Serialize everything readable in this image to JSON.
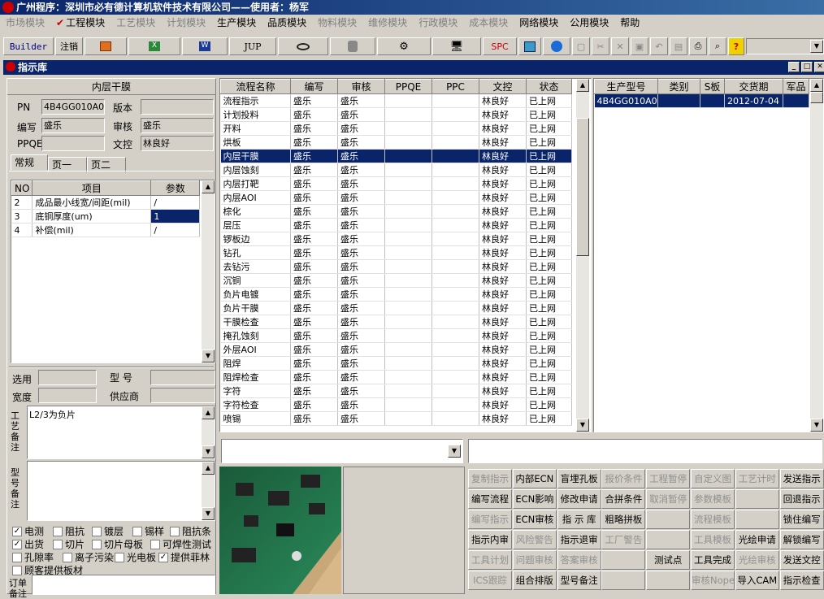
{
  "window": {
    "title": "广州程序：深圳市必有德计算机软件技术有限公司——使用者：杨军"
  },
  "menu": [
    {
      "label": "市场模块",
      "enabled": false
    },
    {
      "label": "工程模块",
      "enabled": true
    },
    {
      "label": "工艺模块",
      "enabled": false
    },
    {
      "label": "计划模块",
      "enabled": false
    },
    {
      "label": "生产模块",
      "enabled": true
    },
    {
      "label": "品质模块",
      "enabled": true
    },
    {
      "label": "物料模块",
      "enabled": false
    },
    {
      "label": "维修模块",
      "enabled": false
    },
    {
      "label": "行政模块",
      "enabled": false
    },
    {
      "label": "成本模块",
      "enabled": false
    },
    {
      "label": "网络模块",
      "enabled": true
    },
    {
      "label": "公用模块",
      "enabled": true
    },
    {
      "label": "帮助",
      "enabled": true
    }
  ],
  "toolbar": {
    "builder": "Builder",
    "logout": "注销",
    "jup": "JUP",
    "spc": "SPC"
  },
  "subwindow": {
    "title": "指示库"
  },
  "left": {
    "header": "内层干膜",
    "pn_label": "PN",
    "pn": "4B4GG010A0",
    "version_label": "版本",
    "version": "",
    "writer_label": "编写",
    "writer": "盛乐",
    "review_label": "审核",
    "review": "盛乐",
    "ppqe_label": "PPQE",
    "ppqe": "",
    "doc_label": "文控",
    "doc": "林良好",
    "tabs": [
      "常规",
      "页一",
      "页二"
    ],
    "param_headers": [
      "NO",
      "项目",
      "参数"
    ],
    "params": [
      {
        "no": "2",
        "item": "成品最小线宽/间距(mil)",
        "value": "/"
      },
      {
        "no": "3",
        "item": "底铜厚度(um)",
        "value": "1"
      },
      {
        "no": "4",
        "item": "补偿(mil)",
        "value": "/"
      }
    ],
    "select_label": "选用",
    "model_label": "型 号",
    "width_label": "宽度",
    "supplier_label": "供应商",
    "process_note_label": "工艺备注",
    "process_note": "L2/3为负片",
    "model_note_label": "型号备注",
    "order_note_label": "订单备注",
    "checks": [
      {
        "label": "电测",
        "checked": true
      },
      {
        "label": "阻抗",
        "checked": false
      },
      {
        "label": "镀层",
        "checked": false
      },
      {
        "label": "锡样",
        "checked": false
      },
      {
        "label": "阻抗条",
        "checked": false
      },
      {
        "label": "出货",
        "checked": true
      },
      {
        "label": "切片",
        "checked": false
      },
      {
        "label": "切片母板",
        "checked": false
      },
      {
        "label": "可焊性测试",
        "checked": false
      },
      {
        "label": "孔隙率",
        "checked": false
      },
      {
        "label": "离子污染",
        "checked": false
      },
      {
        "label": "光电板",
        "checked": false
      },
      {
        "label": "提供菲林",
        "checked": true
      },
      {
        "label": "顾客提供板材",
        "checked": false
      }
    ]
  },
  "flow": {
    "headers": [
      "流程名称",
      "编写",
      "审核",
      "PPQE",
      "PPC",
      "文控",
      "状态"
    ],
    "rows": [
      [
        "流程指示",
        "盛乐",
        "盛乐",
        "",
        "",
        "林良好",
        "已上网"
      ],
      [
        "计划投料",
        "盛乐",
        "盛乐",
        "",
        "",
        "林良好",
        "已上网"
      ],
      [
        "开料",
        "盛乐",
        "盛乐",
        "",
        "",
        "林良好",
        "已上网"
      ],
      [
        "烘板",
        "盛乐",
        "盛乐",
        "",
        "",
        "林良好",
        "已上网"
      ],
      [
        "内层干膜",
        "盛乐",
        "盛乐",
        "",
        "",
        "林良好",
        "已上网"
      ],
      [
        "内层蚀刻",
        "盛乐",
        "盛乐",
        "",
        "",
        "林良好",
        "已上网"
      ],
      [
        "内层打靶",
        "盛乐",
        "盛乐",
        "",
        "",
        "林良好",
        "已上网"
      ],
      [
        "内层AOI",
        "盛乐",
        "盛乐",
        "",
        "",
        "林良好",
        "已上网"
      ],
      [
        "棕化",
        "盛乐",
        "盛乐",
        "",
        "",
        "林良好",
        "已上网"
      ],
      [
        "层压",
        "盛乐",
        "盛乐",
        "",
        "",
        "林良好",
        "已上网"
      ],
      [
        "锣板边",
        "盛乐",
        "盛乐",
        "",
        "",
        "林良好",
        "已上网"
      ],
      [
        "钻孔",
        "盛乐",
        "盛乐",
        "",
        "",
        "林良好",
        "已上网"
      ],
      [
        "去钻污",
        "盛乐",
        "盛乐",
        "",
        "",
        "林良好",
        "已上网"
      ],
      [
        "沉铜",
        "盛乐",
        "盛乐",
        "",
        "",
        "林良好",
        "已上网"
      ],
      [
        "负片电镀",
        "盛乐",
        "盛乐",
        "",
        "",
        "林良好",
        "已上网"
      ],
      [
        "负片干膜",
        "盛乐",
        "盛乐",
        "",
        "",
        "林良好",
        "已上网"
      ],
      [
        "干膜检查",
        "盛乐",
        "盛乐",
        "",
        "",
        "林良好",
        "已上网"
      ],
      [
        "掩孔蚀刻",
        "盛乐",
        "盛乐",
        "",
        "",
        "林良好",
        "已上网"
      ],
      [
        "外层AOI",
        "盛乐",
        "盛乐",
        "",
        "",
        "林良好",
        "已上网"
      ],
      [
        "阻焊",
        "盛乐",
        "盛乐",
        "",
        "",
        "林良好",
        "已上网"
      ],
      [
        "阻焊检查",
        "盛乐",
        "盛乐",
        "",
        "",
        "林良好",
        "已上网"
      ],
      [
        "字符",
        "盛乐",
        "盛乐",
        "",
        "",
        "林良好",
        "已上网"
      ],
      [
        "字符检查",
        "盛乐",
        "盛乐",
        "",
        "",
        "林良好",
        "已上网"
      ],
      [
        "喷锡",
        "盛乐",
        "盛乐",
        "",
        "",
        "林良好",
        "已上网"
      ]
    ],
    "selected_index": 4
  },
  "orders": {
    "headers": [
      "生产型号",
      "类别",
      "S板",
      "交货期",
      "军品"
    ],
    "rows": [
      [
        "4B4GG010A0",
        "",
        "",
        "2012-07-04",
        ""
      ]
    ]
  },
  "commands": [
    [
      "复制指示",
      "内部ECN",
      "盲埋孔板",
      "报价条件",
      "工程暂停",
      "自定义图",
      "工艺计时",
      "发送指示"
    ],
    [
      "编写流程",
      "ECN影响",
      "修改申请",
      "合拼条件",
      "取消暂停",
      "参数模板",
      "",
      "回退指示"
    ],
    [
      "编写指示",
      "ECN审核",
      "指 示 库",
      "粗略拼板",
      "",
      "流程模板",
      "",
      "锁住编写"
    ],
    [
      "指示内审",
      "风险警告",
      "指示退审",
      "工厂警告",
      "",
      "工具模板",
      "光绘申请",
      "解锁编写"
    ],
    [
      "工具计划",
      "问题审核",
      "答案审核",
      "",
      "测试点",
      "工具完成",
      "光绘审核",
      "发送文控"
    ],
    [
      "ICS跟踪",
      "组合排版",
      "型号备注",
      "",
      "",
      "审核Nope",
      "导入CAM",
      "指示检查"
    ]
  ],
  "commands_disabled": [
    [
      true,
      false,
      false,
      true,
      true,
      true,
      true,
      false
    ],
    [
      false,
      false,
      false,
      false,
      true,
      true,
      false,
      false
    ],
    [
      true,
      false,
      false,
      false,
      false,
      true,
      false,
      false
    ],
    [
      false,
      true,
      false,
      true,
      false,
      true,
      false,
      false
    ],
    [
      true,
      true,
      true,
      false,
      false,
      false,
      true,
      false
    ],
    [
      true,
      false,
      false,
      false,
      false,
      true,
      false,
      false
    ]
  ]
}
